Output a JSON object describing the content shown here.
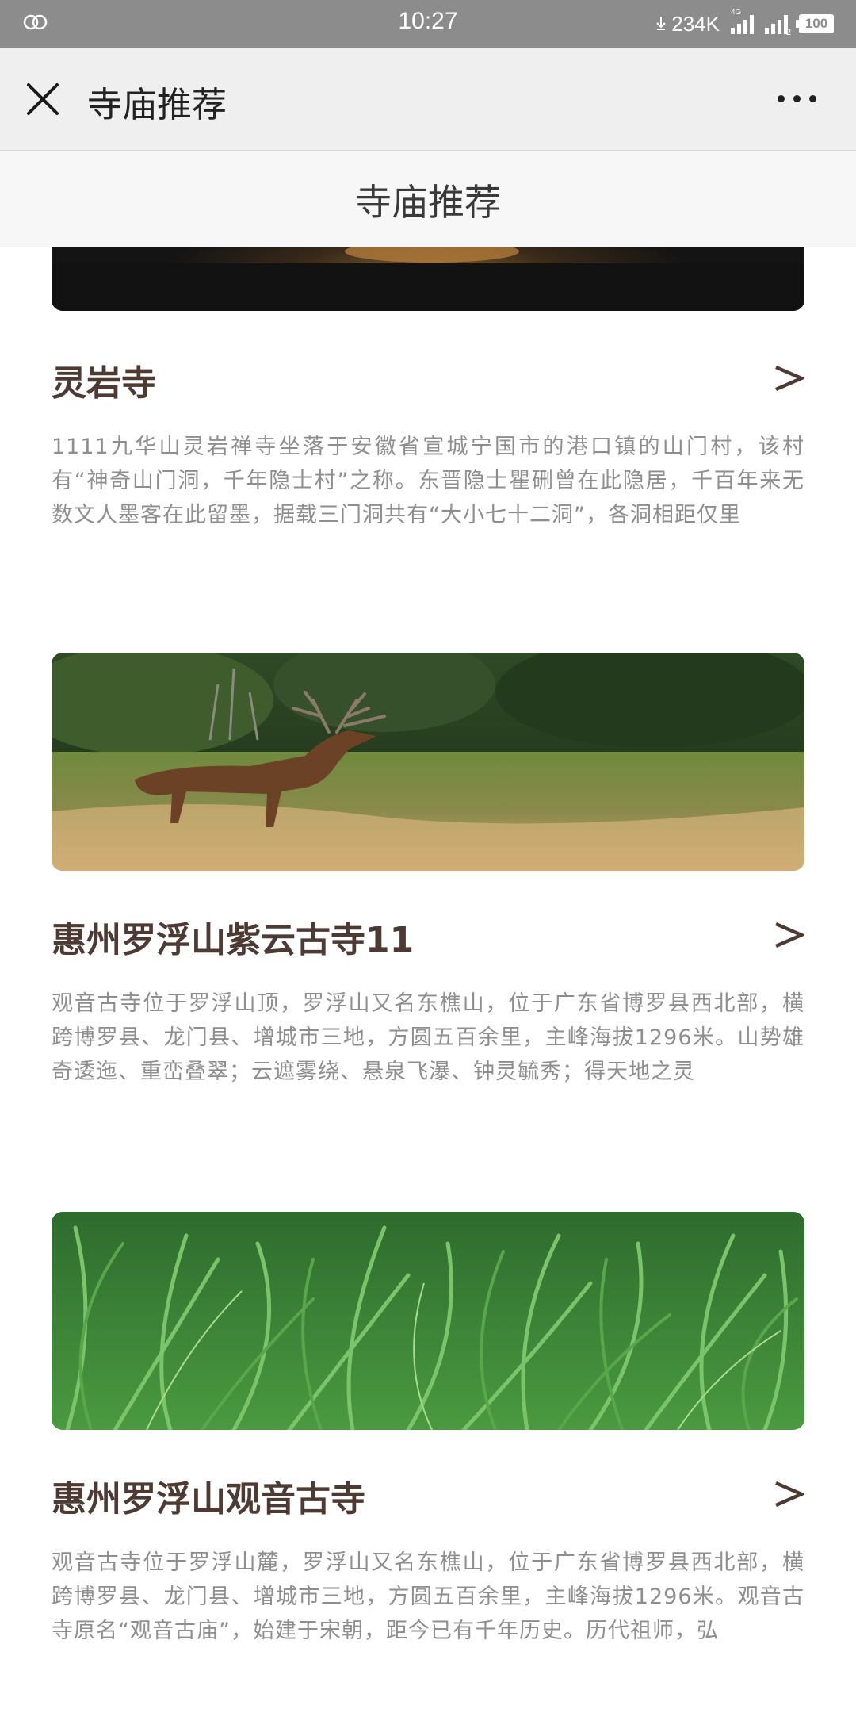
{
  "status_bar": {
    "time": "10:27",
    "speed": "234K",
    "network_tag": "4G",
    "sim2_tag": "2",
    "battery": "100"
  },
  "nav": {
    "title": "寺庙推荐",
    "close_icon": "close-icon",
    "more_icon": "more-dots-icon"
  },
  "page": {
    "header_title": "寺庙推荐"
  },
  "temples": [
    {
      "title": "灵岩寺",
      "image": "temple-image-dark",
      "description": "1111九华山灵岩禅寺坐落于安徽省宣城宁国市的港口镇的山门村，该村有“神奇山门洞，千年隐士村”之称。东晋隐士瞿硎曾在此隐居，千百年来无数文人墨客在此留墨，据载三门洞共有“大小七十二洞”，各洞相距仅里"
    },
    {
      "title": "惠州罗浮山紫云古寺11",
      "image": "deer-meadow-image",
      "description": "观音古寺位于罗浮山顶，罗浮山又名东樵山，位于广东省博罗县西北部，横跨博罗县、龙门县、增城市三地，方圆五百余里，主峰海拔1296米。山势雄奇逶迤、重峦叠翠；云遮雾绕、悬泉飞瀑、钟灵毓秀；得天地之灵"
    },
    {
      "title": "惠州罗浮山观音古寺",
      "image": "green-grass-image",
      "description": "观音古寺位于罗浮山麓，罗浮山又名东樵山，位于广东省博罗县西北部，横跨博罗县、龙门县、增城市三地，方圆五百余里，主峰海拔1296米。观音古寺原名“观音古庙”，始建于宋朝，距今已有千年历史。历代祖师，弘"
    }
  ],
  "colors": {
    "status_bar_bg": "#8c8c8c",
    "nav_bg": "#efefef",
    "title_color": "#4d3b33",
    "desc_color": "#8e8e8e"
  }
}
